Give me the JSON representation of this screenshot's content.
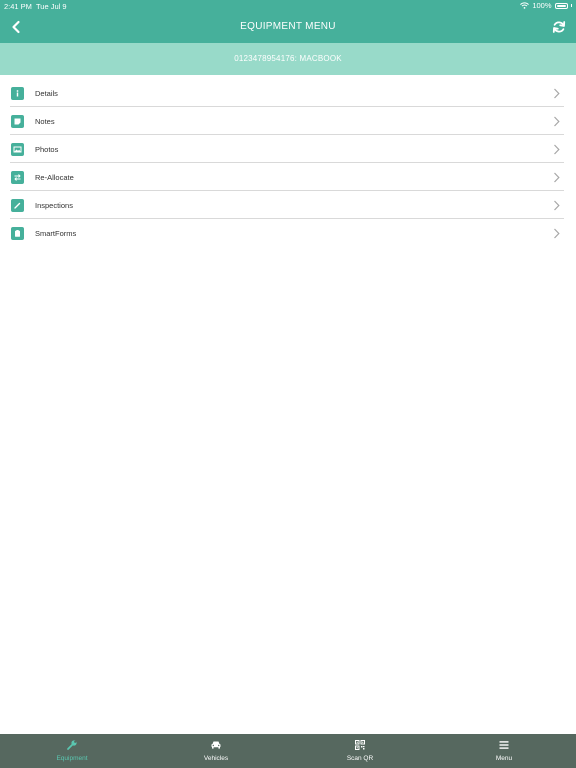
{
  "status_bar": {
    "time": "2:41 PM",
    "date": "Tue Jul 9",
    "battery": "100%"
  },
  "header": {
    "title": "EQUIPMENT MENU"
  },
  "subheader": {
    "text": "0123478954176: MACBOOK"
  },
  "menu": {
    "items": [
      {
        "label": "Details",
        "icon": "info-icon"
      },
      {
        "label": "Notes",
        "icon": "note-icon"
      },
      {
        "label": "Photos",
        "icon": "photo-icon"
      },
      {
        "label": "Re-Allocate",
        "icon": "swap-icon"
      },
      {
        "label": "Inspections",
        "icon": "pencil-icon"
      },
      {
        "label": "SmartForms",
        "icon": "clipboard-icon"
      }
    ]
  },
  "tabs": [
    {
      "label": "Equipment",
      "icon": "wrench-icon",
      "active": true
    },
    {
      "label": "Vehicles",
      "icon": "car-icon",
      "active": false
    },
    {
      "label": "Scan QR",
      "icon": "qr-code-icon",
      "active": false
    },
    {
      "label": "Menu",
      "icon": "menu-icon",
      "active": false
    }
  ],
  "colors": {
    "primary": "#46b09b",
    "subheader": "#98dac9",
    "tab_bar": "#56685f",
    "active_tab": "#5ac7b0"
  }
}
